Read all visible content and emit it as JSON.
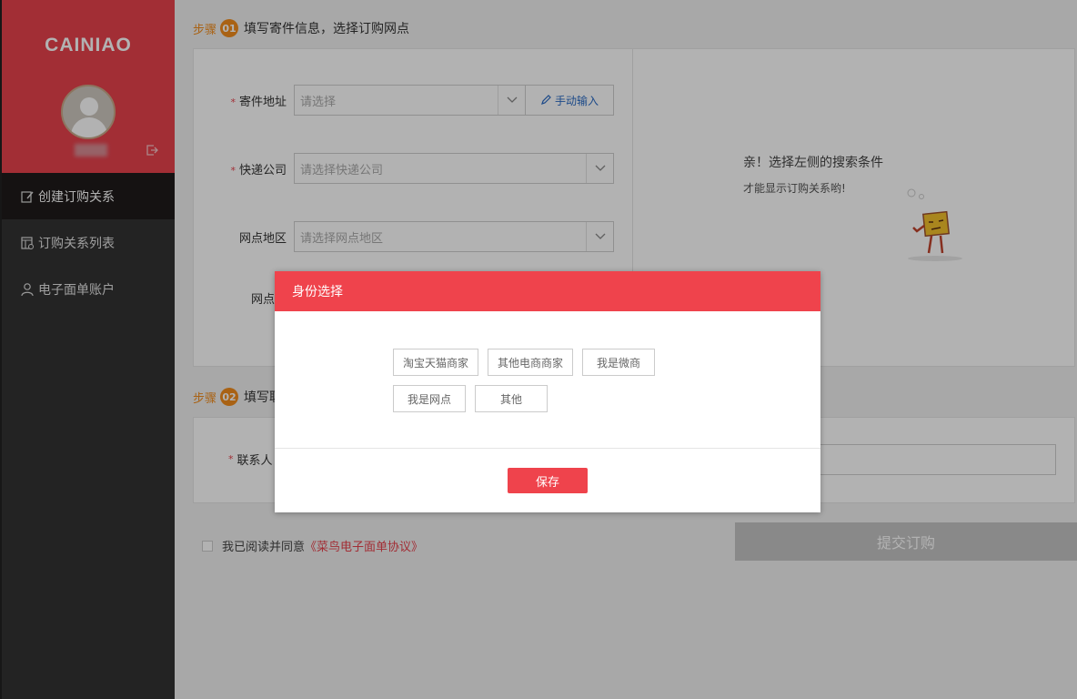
{
  "brand": "CAINIAO",
  "sidebar": {
    "items": [
      {
        "label": "创建订购关系",
        "icon": "edit-icon",
        "active": true
      },
      {
        "label": "订购关系列表",
        "icon": "list-icon",
        "active": false
      },
      {
        "label": "电子面单账户",
        "icon": "user-icon",
        "active": false
      }
    ]
  },
  "step1": {
    "label": "步骤",
    "num": "01",
    "title": "填写寄件信息，选择订购网点",
    "fields": {
      "address": {
        "label": "寄件地址",
        "placeholder": "请选择",
        "manual": "手动输入"
      },
      "courier": {
        "label": "快递公司",
        "placeholder": "请选择快递公司"
      },
      "region": {
        "label": "网点地区",
        "placeholder": "请选择网点地区"
      },
      "code": {
        "label": "网点编"
      }
    },
    "empty_title": "亲！选择左侧的搜索条件",
    "empty_sub": "才能显示订购关系哟!"
  },
  "step2": {
    "label": "步骤",
    "num": "02",
    "title": "填写联",
    "contact_label": "联系人"
  },
  "agree": {
    "text": "我已阅读并同意",
    "link": "《菜鸟电子面单协议》"
  },
  "submit_label": "提交订购",
  "modal": {
    "title": "身份选择",
    "options": [
      "淘宝天猫商家",
      "其他电商商家",
      "我是微商",
      "我是网点",
      "其他"
    ],
    "save_label": "保存"
  },
  "colors": {
    "brand_red": "#e8424d",
    "step_orange": "#f28d1d",
    "sidebar_dark": "#333333"
  }
}
